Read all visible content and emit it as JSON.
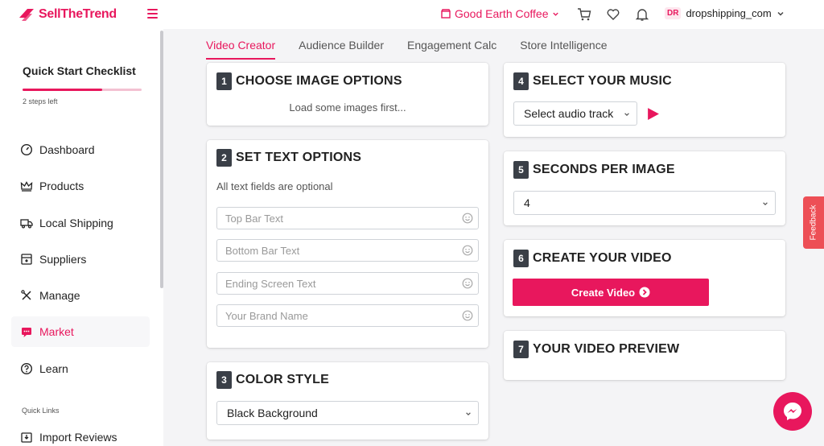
{
  "brand": {
    "name": "SellTheTrend",
    "accent": "#e8175d"
  },
  "header": {
    "store": "Good Earth Coffee",
    "user_initials": "DR",
    "username": "dropshipping_com",
    "icons": [
      "cart-icon",
      "heart-icon",
      "bell-icon"
    ]
  },
  "sidebar": {
    "checklist_title": "Quick Start Checklist",
    "checklist_progress": 0.67,
    "steps_left": "2 steps left",
    "items": [
      {
        "label": "Dashboard",
        "icon": "dashboard-icon"
      },
      {
        "label": "Products",
        "icon": "crown-icon"
      },
      {
        "label": "Local Shipping",
        "icon": "truck-icon"
      },
      {
        "label": "Suppliers",
        "icon": "box-icon"
      },
      {
        "label": "Manage",
        "icon": "tools-icon"
      },
      {
        "label": "Market",
        "icon": "megaphone-icon",
        "active": true
      },
      {
        "label": "Learn",
        "icon": "question-icon"
      }
    ],
    "quick_links_label": "Quick Links",
    "quick_links": [
      {
        "label": "Import Reviews",
        "icon": "import-icon"
      }
    ]
  },
  "tabs": [
    "Video Creator",
    "Audience Builder",
    "Engagement Calc",
    "Store Intelligence"
  ],
  "sections": {
    "image_options": {
      "num": "1",
      "title": "CHOOSE IMAGE OPTIONS",
      "message": "Load some images first..."
    },
    "text_options": {
      "num": "2",
      "title": "SET TEXT OPTIONS",
      "hint": "All text fields are optional",
      "fields": [
        "Top Bar Text",
        "Bottom Bar Text",
        "Ending Screen Text",
        "Your Brand Name"
      ]
    },
    "color_style": {
      "num": "3",
      "title": "COLOR STYLE",
      "selected": "Black Background"
    },
    "music": {
      "num": "4",
      "title": "SELECT YOUR MUSIC",
      "selected": "Select audio track"
    },
    "seconds": {
      "num": "5",
      "title": "SECONDS PER IMAGE",
      "selected": "4"
    },
    "create": {
      "num": "6",
      "title": "CREATE YOUR VIDEO",
      "button": "Create Video"
    },
    "preview": {
      "num": "7",
      "title": "YOUR VIDEO PREVIEW"
    }
  },
  "feedback_label": "Feedback"
}
